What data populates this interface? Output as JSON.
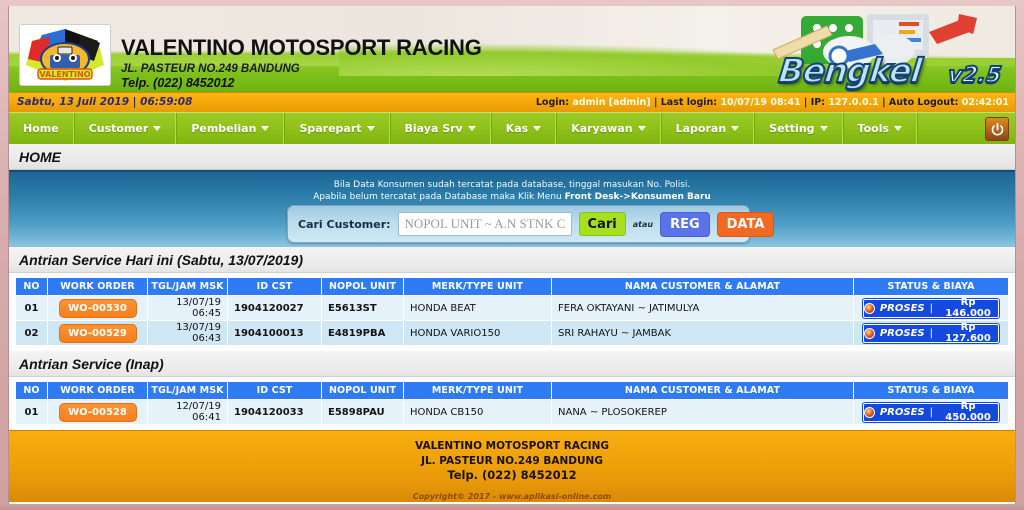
{
  "header": {
    "company": "VALENTINO MOTOSPORT RACING",
    "address": "JL. PASTEUR NO.249 BANDUNG",
    "phone": "Telp. (022) 8452012",
    "app_name": "Bengkel",
    "app_version": "v2.5",
    "logo_text": "VALENTINO"
  },
  "statusbar": {
    "datetime": "Sabtu, 13 Juli 2019 | 06:59:08",
    "login_label": "Login:",
    "login_value": "admin [admin]",
    "lastlogin_label": "Last login:",
    "lastlogin_value": "10/07/19 08:41",
    "ip_label": "IP:",
    "ip_value": "127.0.0.1",
    "autologout_label": "Auto Logout:",
    "autologout_value": "02:42:01",
    "sep": "|"
  },
  "nav": {
    "items": [
      {
        "label": "Home",
        "caret": false
      },
      {
        "label": "Customer",
        "caret": true
      },
      {
        "label": "Pembelian",
        "caret": true
      },
      {
        "label": "Sparepart",
        "caret": true
      },
      {
        "label": "Biaya Srv",
        "caret": true
      },
      {
        "label": "Kas",
        "caret": true
      },
      {
        "label": "Karyawan",
        "caret": true
      },
      {
        "label": "Laporan",
        "caret": true
      },
      {
        "label": "Setting",
        "caret": true
      },
      {
        "label": "Tools",
        "caret": true
      }
    ],
    "logout_icon": "power-icon"
  },
  "page_title": "HOME",
  "search_panel": {
    "hint_line1": "Bila Data Konsumen sudah tercatat pada database, tinggal masukan No. Polisi.",
    "hint_line2_prefix": "Apabila belum tercatat pada Database maka Klik Menu ",
    "hint_line2_bold": "Front Desk->Konsumen Baru",
    "label": "Cari Customer:",
    "input_value": "",
    "input_placeholder": "NOPOL UNIT ~ A.N STNK CST",
    "btn_cari": "Cari",
    "atau": "atau",
    "btn_reg": "REG",
    "btn_data": "DATA"
  },
  "columns": [
    "NO",
    "WORK ORDER",
    "TGL/JAM MSK",
    "ID CST",
    "NOPOL UNIT",
    "MERK/TYPE UNIT",
    "NAMA CUSTOMER & ALAMAT",
    "STATUS & BIAYA"
  ],
  "section_today": {
    "title": "Antrian Service Hari ini (Sabtu, 13/07/2019)",
    "rows": [
      {
        "no": "01",
        "work_order": "WO-00530",
        "tgl_jam": "13/07/19 06:45",
        "id_cst": "1904120027",
        "nopol": "E5613ST",
        "merk": "HONDA BEAT",
        "nama_alamat": "FERA OKTAYANI ~ JATIMULYA",
        "status": "PROSES",
        "sep": "|",
        "biaya": "Rp 146.000"
      },
      {
        "no": "02",
        "work_order": "WO-00529",
        "tgl_jam": "13/07/19 06:43",
        "id_cst": "1904100013",
        "nopol": "E4819PBA",
        "merk": "HONDA VARIO150",
        "nama_alamat": "SRI RAHAYU ~ JAMBAK",
        "status": "PROSES",
        "sep": "|",
        "biaya": "Rp 127.600"
      }
    ]
  },
  "section_inap": {
    "title": "Antrian Service (Inap)",
    "rows": [
      {
        "no": "01",
        "work_order": "WO-00528",
        "tgl_jam": "12/07/19 06:41",
        "id_cst": "1904120033",
        "nopol": "E5898PAU",
        "merk": "HONDA CB150",
        "nama_alamat": "NANA ~ PLOSOKEREP",
        "status": "PROSES",
        "sep": "|",
        "biaya": "Rp 450.000"
      }
    ]
  },
  "footer": {
    "line1": "VALENTINO MOTOSPORT RACING",
    "line2": "JL. PASTEUR NO.249 BANDUNG",
    "line3": "Telp. (022) 8452012",
    "copyright": "Copyright© 2017 - www.aplikasi-online.com"
  },
  "colors": {
    "nav_green": "#8ec21a",
    "status_orange": "#f4a809",
    "table_header_blue": "#2f7bf5",
    "wo_orange": "#f57f1c",
    "proses_blue": "#1449e0",
    "reg_blue": "#5b73e8",
    "data_orange": "#f26a21",
    "cari_green": "#a6e01e"
  }
}
